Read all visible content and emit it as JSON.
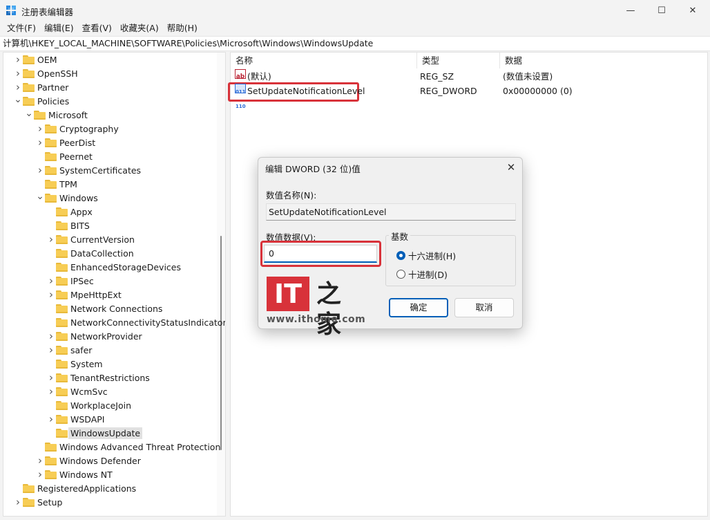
{
  "window": {
    "title": "注册表编辑器",
    "min_glyph": "—",
    "max_glyph": "☐",
    "close_glyph": "✕"
  },
  "menu": [
    "文件(F)",
    "编辑(E)",
    "查看(V)",
    "收藏夹(A)",
    "帮助(H)"
  ],
  "address": "计算机\\HKEY_LOCAL_MACHINE\\SOFTWARE\\Policies\\Microsoft\\Windows\\WindowsUpdate",
  "tree": [
    {
      "label": "OEM",
      "level": 0,
      "chevron": ">",
      "icon": "folder-icon"
    },
    {
      "label": "OpenSSH",
      "level": 0,
      "chevron": ">",
      "icon": "folder-icon"
    },
    {
      "label": "Partner",
      "level": 0,
      "chevron": ">",
      "icon": "folder-icon"
    },
    {
      "label": "Policies",
      "level": 0,
      "chevron": "v",
      "icon": "folder-icon"
    },
    {
      "label": "Microsoft",
      "level": 1,
      "chevron": "v",
      "icon": "folder-icon"
    },
    {
      "label": "Cryptography",
      "level": 2,
      "chevron": ">",
      "icon": "folder-icon"
    },
    {
      "label": "PeerDist",
      "level": 2,
      "chevron": ">",
      "icon": "folder-icon"
    },
    {
      "label": "Peernet",
      "level": 2,
      "chevron": "",
      "icon": "folder-icon"
    },
    {
      "label": "SystemCertificates",
      "level": 2,
      "chevron": ">",
      "icon": "folder-icon"
    },
    {
      "label": "TPM",
      "level": 2,
      "chevron": "",
      "icon": "folder-icon"
    },
    {
      "label": "Windows",
      "level": 2,
      "chevron": "v",
      "icon": "folder-icon"
    },
    {
      "label": "Appx",
      "level": 3,
      "chevron": "",
      "icon": "folder-icon"
    },
    {
      "label": "BITS",
      "level": 3,
      "chevron": "",
      "icon": "folder-icon"
    },
    {
      "label": "CurrentVersion",
      "level": 3,
      "chevron": ">",
      "icon": "folder-icon"
    },
    {
      "label": "DataCollection",
      "level": 3,
      "chevron": "",
      "icon": "folder-icon"
    },
    {
      "label": "EnhancedStorageDevices",
      "level": 3,
      "chevron": "",
      "icon": "folder-icon"
    },
    {
      "label": "IPSec",
      "level": 3,
      "chevron": ">",
      "icon": "folder-icon"
    },
    {
      "label": "MpeHttpExt",
      "level": 3,
      "chevron": ">",
      "icon": "folder-icon"
    },
    {
      "label": "Network Connections",
      "level": 3,
      "chevron": "",
      "icon": "folder-icon"
    },
    {
      "label": "NetworkConnectivityStatusIndicator",
      "level": 3,
      "chevron": "",
      "icon": "folder-icon"
    },
    {
      "label": "NetworkProvider",
      "level": 3,
      "chevron": ">",
      "icon": "folder-icon"
    },
    {
      "label": "safer",
      "level": 3,
      "chevron": ">",
      "icon": "folder-icon"
    },
    {
      "label": "System",
      "level": 3,
      "chevron": "",
      "icon": "folder-icon"
    },
    {
      "label": "TenantRestrictions",
      "level": 3,
      "chevron": ">",
      "icon": "folder-icon"
    },
    {
      "label": "WcmSvc",
      "level": 3,
      "chevron": ">",
      "icon": "folder-icon"
    },
    {
      "label": "WorkplaceJoin",
      "level": 3,
      "chevron": "",
      "icon": "folder-icon"
    },
    {
      "label": "WSDAPI",
      "level": 3,
      "chevron": ">",
      "icon": "folder-icon"
    },
    {
      "label": "WindowsUpdate",
      "level": 3,
      "chevron": "",
      "icon": "folder-icon",
      "selected": true
    },
    {
      "label": "Windows Advanced Threat Protection",
      "level": 2,
      "chevron": "",
      "icon": "folder-icon"
    },
    {
      "label": "Windows Defender",
      "level": 2,
      "chevron": ">",
      "icon": "folder-icon"
    },
    {
      "label": "Windows NT",
      "level": 2,
      "chevron": ">",
      "icon": "folder-icon"
    },
    {
      "label": "RegisteredApplications",
      "level": 0,
      "chevron": "",
      "icon": "folder-icon"
    },
    {
      "label": "Setup",
      "level": 0,
      "chevron": ">",
      "icon": "folder-icon"
    }
  ],
  "list": {
    "columns": {
      "name": "名称",
      "type": "类型",
      "data": "数据"
    },
    "rows": [
      {
        "icon": "string-value-icon",
        "icon_text": "ab",
        "name": "(默认)",
        "type": "REG_SZ",
        "data": "(数值未设置)"
      },
      {
        "icon": "binary-value-icon",
        "icon_text": "011\n110",
        "name": "SetUpdateNotificationLevel",
        "type": "REG_DWORD",
        "data": "0x00000000 (0)"
      }
    ]
  },
  "dialog": {
    "title": "编辑 DWORD (32 位)值",
    "close_glyph": "✕",
    "name_label": "数值名称(N):",
    "name_value": "SetUpdateNotificationLevel",
    "data_label": "数值数据(V):",
    "data_value": "0",
    "base_label": "基数",
    "radio_hex": "十六进制(H)",
    "radio_dec": "十进制(D)",
    "ok": "确定",
    "cancel": "取消"
  },
  "watermark": {
    "logo_left": "IT",
    "logo_right": "之家",
    "url": "www.ithome.com"
  },
  "accent_color": "#005fb8",
  "highlight_color": "#d8323a"
}
